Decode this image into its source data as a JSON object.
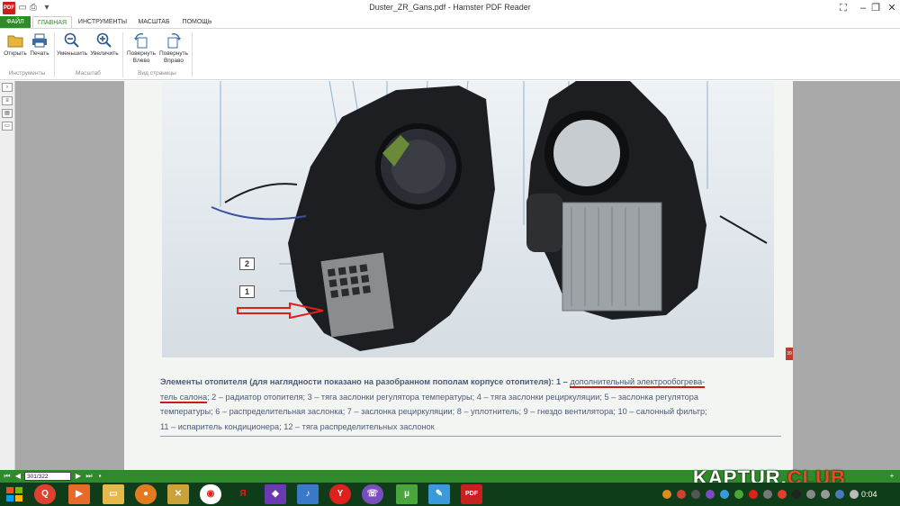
{
  "window": {
    "title": "Duster_ZR_Gans.pdf - Hamster PDF Reader",
    "app_logo_text": "PDF"
  },
  "tabs": [
    "ФАЙЛ",
    "ГЛАВНАЯ",
    "ИНСТРУМЕНТЫ",
    "МАСШТАБ",
    "ПОМОЩЬ"
  ],
  "ribbon": {
    "open": "Открыть",
    "print": "Печать",
    "zoom_out": "Уменьшить",
    "zoom_in": "Увеличить",
    "rotate_left": "Повернуть Влево",
    "rotate_right": "Повернуть Вправо",
    "group_tools": "Инструменты",
    "group_zoom": "Масштаб",
    "group_view": "Вид страницы"
  },
  "document": {
    "callout_1": "1",
    "callout_2": "2",
    "page_marker": "39",
    "caption": {
      "lead": "Элементы отопителя (для наглядности показано на разобранном пополам корпусе отопителя): 1 – ",
      "underlined_1": "дополнительный электрообогрева-",
      "underlined_2": "тель салона",
      "line2_rest": "; 2 – радиатор отопителя; 3 – тяга заслонки регулятора температуры; 4 – тяга заслонки рециркуляции; 5 – заслонка регулятора",
      "line3": "температуры; 6 – распределительная заслонка; 7 – заслонка рециркуляции; 8 – уплотнитель; 9 – гнездо вентилятора; 10 – салонный фильтр;",
      "line4": "11 – испаритель кондиционера; 12 – тяга распределительных заслонок"
    }
  },
  "statusbar": {
    "page_value": "301/322"
  },
  "taskbar": {
    "clock": "0:04"
  },
  "watermark": {
    "kaptur": "KAPTUR.",
    "club": "CLUB"
  },
  "colors": {
    "accent": "#2f8b2a",
    "taskbar": "#0f3d1a",
    "underline": "#d01818",
    "caption_text": "#4b5a78"
  }
}
